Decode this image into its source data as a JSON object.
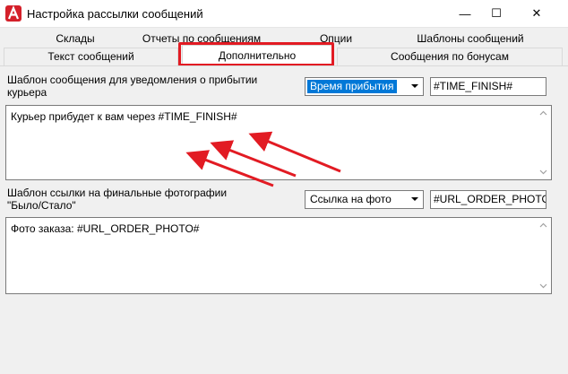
{
  "window": {
    "title": "Настройка рассылки сообщений",
    "minimize_glyph": "—",
    "maximize_glyph": "☐",
    "close_glyph": "✕"
  },
  "tabs": {
    "row1": [
      "Склады",
      "Отчеты по сообщениям",
      "Опции",
      "Шаблоны сообщений"
    ],
    "row2": [
      "Текст сообщений",
      "Дополнительно",
      "Сообщения по бонусам"
    ],
    "active": "Дополнительно"
  },
  "arrival": {
    "label": "Шаблон сообщения для уведомления о прибытии курьера",
    "combo_value": "Время прибытия",
    "macro": "#TIME_FINISH#",
    "text": "Курьер прибудет к вам через #TIME_FINISH#"
  },
  "photo": {
    "label_line1": "Шаблон ссылки на финальные фотографии",
    "label_line2": "\"Было/Стало\"",
    "combo_value": "Ссылка на фото",
    "macro": "#URL_ORDER_PHOTO#",
    "text": "Фото заказа: #URL_ORDER_PHOTO#"
  },
  "colors": {
    "annotation_red": "#e21b23",
    "selection_blue": "#0078d7",
    "window_bg": "#f0f0f0"
  }
}
